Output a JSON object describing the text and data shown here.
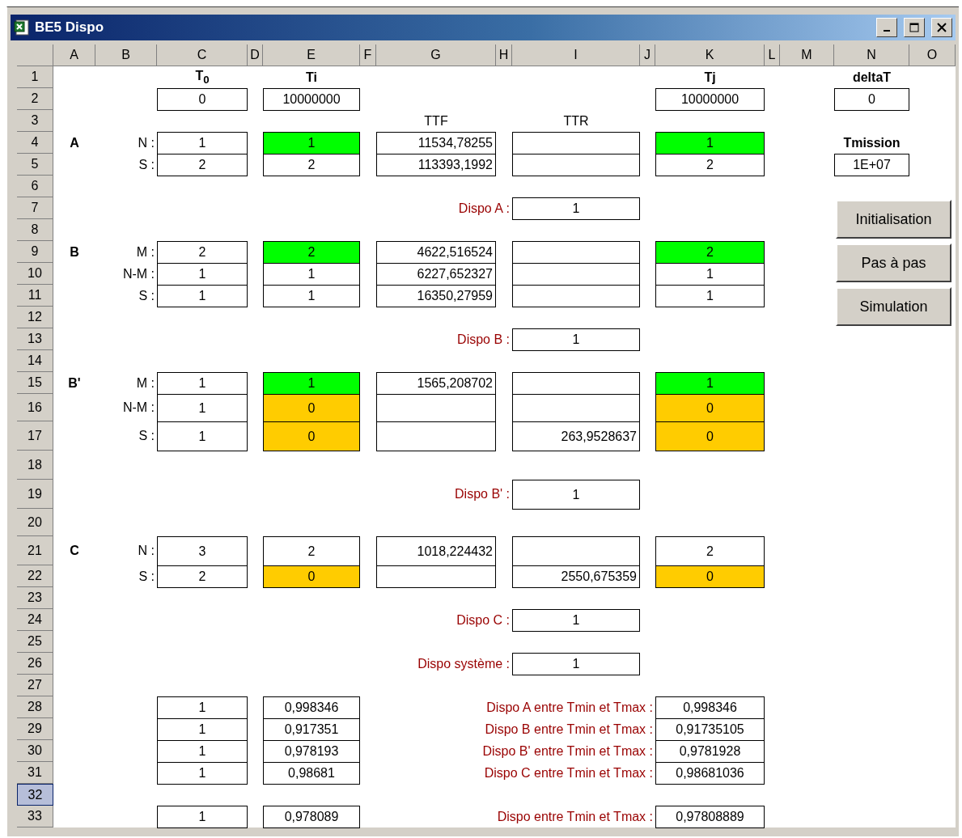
{
  "window": {
    "title": "BE5 Dispo"
  },
  "columns": [
    "A",
    "B",
    "C",
    "D",
    "E",
    "F",
    "G",
    "H",
    "I",
    "J",
    "K",
    "L",
    "M",
    "N",
    "O"
  ],
  "rows": [
    {
      "number": "1",
      "selected": false,
      "cells": {
        "t0": {
          "kind": "heading",
          "text": "T$_{0}$"
        },
        "ti": {
          "kind": "heading",
          "text": "Ti"
        },
        "tj": {
          "kind": "heading",
          "text": "Tj"
        },
        "side": {
          "kind": "heading",
          "text": "deltaT"
        }
      }
    },
    {
      "number": "2",
      "selected": false,
      "cells": {
        "t0": {
          "kind": "value",
          "text": "0"
        },
        "ti": {
          "kind": "value",
          "text": "10000000"
        },
        "tj": {
          "kind": "value",
          "text": "10000000"
        },
        "side": {
          "kind": "value",
          "text": "0"
        }
      }
    },
    {
      "number": "3",
      "selected": false,
      "cells": {
        "ttf": {
          "kind": "caption",
          "text": "TTF"
        },
        "ttr": {
          "kind": "caption",
          "text": "TTR"
        }
      }
    },
    {
      "number": "4",
      "selected": false,
      "cells": {
        "group": "A",
        "label": "N :",
        "t0": {
          "kind": "value",
          "text": "1"
        },
        "ti": {
          "kind": "value",
          "text": "1",
          "color": "#00ff00"
        },
        "ttf": {
          "kind": "value",
          "text": "11534,78255"
        },
        "ttr": {
          "kind": "value"
        },
        "tj": {
          "kind": "value",
          "text": "1",
          "color": "#00ff00"
        },
        "side": {
          "kind": "heading",
          "text": "Tmission"
        }
      }
    },
    {
      "number": "5",
      "selected": false,
      "cells": {
        "label": "S :",
        "t0": {
          "kind": "value",
          "text": "2"
        },
        "ti": {
          "kind": "value",
          "text": "2"
        },
        "ttf": {
          "kind": "value",
          "text": "113393,1992"
        },
        "ttr": {
          "kind": "value"
        },
        "tj": {
          "kind": "value",
          "text": "2"
        },
        "side": {
          "kind": "value",
          "text": "1E+07"
        }
      }
    },
    {
      "number": "6",
      "selected": false
    },
    {
      "number": "7",
      "selected": false,
      "cells": {
        "prompt": "Dispo A :",
        "result": {
          "kind": "value",
          "text": "1"
        }
      }
    },
    {
      "number": "8",
      "selected": false
    },
    {
      "number": "9",
      "selected": false,
      "cells": {
        "group": "B",
        "label": "M :",
        "t0": {
          "kind": "value",
          "text": "2"
        },
        "ti": {
          "kind": "value",
          "text": "2",
          "color": "#00ff00"
        },
        "ttf": {
          "kind": "value",
          "text": "4622,516524"
        },
        "ttr": {
          "kind": "value"
        },
        "tj": {
          "kind": "value",
          "text": "2",
          "color": "#00ff00"
        }
      }
    },
    {
      "number": "10",
      "selected": false,
      "cells": {
        "label": "N-M :",
        "t0": {
          "kind": "value",
          "text": "1"
        },
        "ti": {
          "kind": "value",
          "text": "1"
        },
        "ttf": {
          "kind": "value",
          "text": "6227,652327"
        },
        "ttr": {
          "kind": "value"
        },
        "tj": {
          "kind": "value",
          "text": "1"
        }
      }
    },
    {
      "number": "11",
      "selected": false,
      "cells": {
        "label": "S :",
        "t0": {
          "kind": "value",
          "text": "1"
        },
        "ti": {
          "kind": "value",
          "text": "1"
        },
        "ttf": {
          "kind": "value",
          "text": "16350,27959"
        },
        "ttr": {
          "kind": "value"
        },
        "tj": {
          "kind": "value",
          "text": "1"
        }
      }
    },
    {
      "number": "12",
      "selected": false
    },
    {
      "number": "13",
      "selected": false,
      "cells": {
        "prompt": "Dispo B :",
        "result": {
          "kind": "value",
          "text": "1"
        }
      }
    },
    {
      "number": "14",
      "selected": false
    },
    {
      "number": "15",
      "selected": false,
      "cells": {
        "group": "B'",
        "label": "M :",
        "t0": {
          "kind": "value",
          "text": "1"
        },
        "ti": {
          "kind": "value",
          "text": "1",
          "color": "#00ff00"
        },
        "ttf": {
          "kind": "value",
          "text": "1565,208702"
        },
        "ttr": {
          "kind": "value"
        },
        "tj": {
          "kind": "value",
          "text": "1",
          "color": "#00ff00"
        }
      }
    },
    {
      "number": "16",
      "selected": false,
      "cells": {
        "label": "N-M :",
        "t0": {
          "kind": "value",
          "text": "1"
        },
        "ti": {
          "kind": "value",
          "text": "0",
          "color": "#ffcc00"
        },
        "ttf": {
          "kind": "value"
        },
        "ttr": {
          "kind": "value"
        },
        "tj": {
          "kind": "value",
          "text": "0",
          "color": "#ffcc00"
        }
      }
    },
    {
      "number": "17",
      "selected": false,
      "cells": {
        "label": "S :",
        "t0": {
          "kind": "value",
          "text": "1"
        },
        "ti": {
          "kind": "value",
          "text": "0",
          "color": "#ffcc00"
        },
        "ttf": {
          "kind": "value"
        },
        "ttr": {
          "kind": "value",
          "text": "263,9528637"
        },
        "tj": {
          "kind": "value",
          "text": "0",
          "color": "#ffcc00"
        }
      }
    },
    {
      "number": "18",
      "selected": false
    },
    {
      "number": "19",
      "selected": false,
      "cells": {
        "prompt": "Dispo B' :",
        "result": {
          "kind": "value",
          "text": "1"
        }
      }
    },
    {
      "number": "20",
      "selected": false
    },
    {
      "number": "21",
      "selected": false,
      "cells": {
        "group": "C",
        "label": "N :",
        "t0": {
          "kind": "value",
          "text": "3"
        },
        "ti": {
          "kind": "value",
          "text": "2"
        },
        "ttf": {
          "kind": "value",
          "text": "1018,224432"
        },
        "ttr": {
          "kind": "value"
        },
        "tj": {
          "kind": "value",
          "text": "2"
        }
      }
    },
    {
      "number": "22",
      "selected": false,
      "cells": {
        "label": "S :",
        "t0": {
          "kind": "value",
          "text": "2"
        },
        "ti": {
          "kind": "value",
          "text": "0",
          "color": "#ffcc00"
        },
        "ttf": {
          "kind": "value"
        },
        "ttr": {
          "kind": "value",
          "text": "2550,675359"
        },
        "tj": {
          "kind": "value",
          "text": "0",
          "color": "#ffcc00"
        }
      }
    },
    {
      "number": "23",
      "selected": false
    },
    {
      "number": "24",
      "selected": false,
      "cells": {
        "prompt": "Dispo C :",
        "result": {
          "kind": "value",
          "text": "1"
        }
      }
    },
    {
      "number": "25",
      "selected": false
    },
    {
      "number": "26",
      "selected": false,
      "cells": {
        "prompt": "Dispo système :",
        "result": {
          "kind": "value",
          "text": "1"
        }
      }
    },
    {
      "number": "27",
      "selected": false
    },
    {
      "number": "28",
      "selected": false,
      "cells": {
        "t0": {
          "kind": "value",
          "text": "1"
        },
        "ti": {
          "kind": "value",
          "text": "0,998346"
        },
        "interval_prompt": "Dispo A entre Tmin et Tmax :",
        "tj": {
          "kind": "value",
          "text": "0,998346"
        }
      }
    },
    {
      "number": "29",
      "selected": false,
      "cells": {
        "t0": {
          "kind": "value",
          "text": "1"
        },
        "ti": {
          "kind": "value",
          "text": "0,917351"
        },
        "interval_prompt": "Dispo B entre Tmin et Tmax :",
        "tj": {
          "kind": "value",
          "text": "0,91735105"
        }
      }
    },
    {
      "number": "30",
      "selected": false,
      "cells": {
        "t0": {
          "kind": "value",
          "text": "1"
        },
        "ti": {
          "kind": "value",
          "text": "0,978193"
        },
        "interval_prompt": "Dispo B' entre Tmin et Tmax :",
        "tj": {
          "kind": "value",
          "text": "0,9781928"
        }
      }
    },
    {
      "number": "31",
      "selected": false,
      "cells": {
        "t0": {
          "kind": "value",
          "text": "1"
        },
        "ti": {
          "kind": "value",
          "text": "0,98681"
        },
        "interval_prompt": "Dispo C entre Tmin et Tmax :",
        "tj": {
          "kind": "value",
          "text": "0,98681036"
        }
      }
    },
    {
      "number": "32",
      "selected": true
    },
    {
      "number": "33",
      "selected": false,
      "cells": {
        "t0": {
          "kind": "value",
          "text": "1"
        },
        "ti": {
          "kind": "value",
          "text": "0,978089"
        },
        "interval_prompt": "Dispo entre Tmin et Tmax :",
        "tj": {
          "kind": "value",
          "text": "0,97808889"
        }
      }
    }
  ],
  "buttons": [
    "Initialisation",
    "Pas à pas",
    "Simulation"
  ]
}
